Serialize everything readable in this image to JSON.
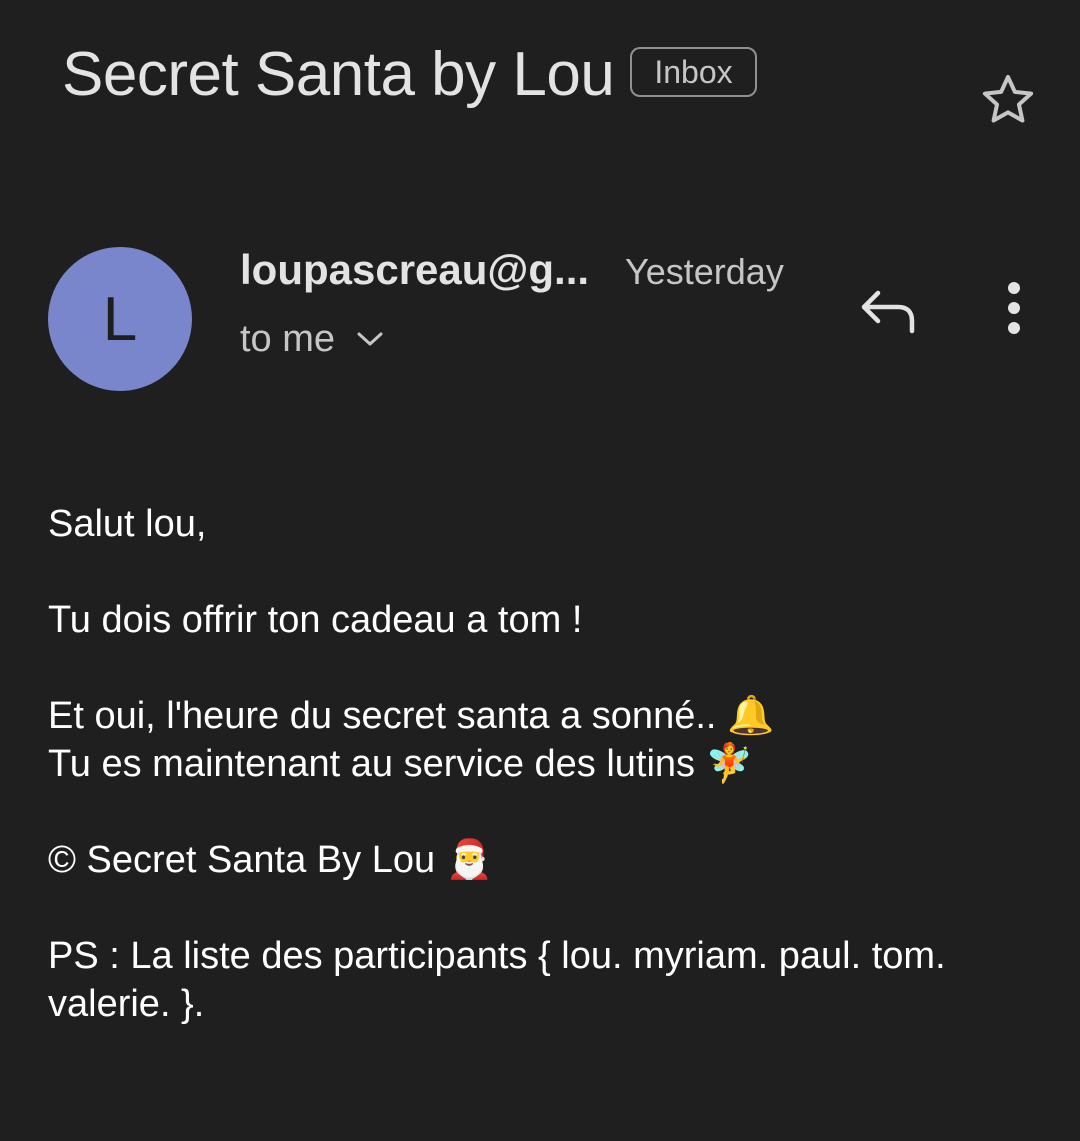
{
  "header": {
    "subject": "Secret Santa by Lou",
    "label": "Inbox",
    "star_icon": "star-outline-icon"
  },
  "message": {
    "avatar_letter": "L",
    "avatar_color": "#7986cb",
    "sender": "loupascreau@g...",
    "date": "Yesterday",
    "recipient": "to me",
    "reply_icon": "reply-icon",
    "more_icon": "more-vert-icon",
    "expand_icon": "chevron-down-icon"
  },
  "body": {
    "greeting": "Salut lou,",
    "line1": "Tu dois offrir ton cadeau a tom !",
    "line2": "Et oui, l'heure du secret santa a sonné.. 🔔",
    "line3": "Tu es maintenant au service des lutins 🧚",
    "signature": "© Secret Santa By Lou 🎅",
    "ps": "PS : La liste des participants { lou. myriam. paul. tom. valerie.  }."
  }
}
